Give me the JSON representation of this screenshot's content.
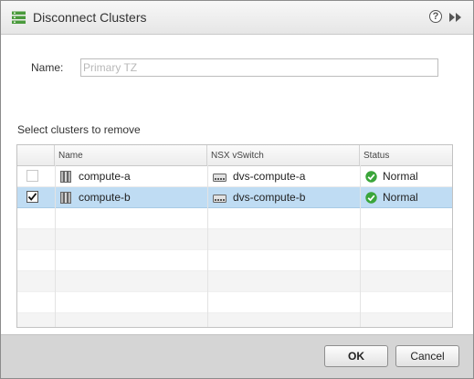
{
  "dialog": {
    "title": "Disconnect Clusters",
    "help_glyph": "?"
  },
  "form": {
    "name_label": "Name:",
    "name_placeholder": "Primary TZ"
  },
  "section": {
    "title": "Select clusters to remove"
  },
  "table": {
    "columns": [
      "",
      "Name",
      "NSX vSwitch",
      "Status"
    ],
    "rows": [
      {
        "checked": false,
        "name": "compute-a",
        "vswitch": "dvs-compute-a",
        "status": "Normal",
        "selected": false
      },
      {
        "checked": true,
        "name": "compute-b",
        "vswitch": "dvs-compute-b",
        "status": "Normal",
        "selected": true
      }
    ]
  },
  "buttons": {
    "ok": "OK",
    "cancel": "Cancel"
  },
  "colors": {
    "selected_row": "#bfdcf3",
    "status_ok": "#3aa53a"
  },
  "icons": {
    "title": "cluster-list-icon",
    "help": "help-icon",
    "expand": "double-chevron-right-icon",
    "cluster": "cluster-icon",
    "vswitch": "vswitch-icon",
    "status": "check-circle-icon"
  }
}
